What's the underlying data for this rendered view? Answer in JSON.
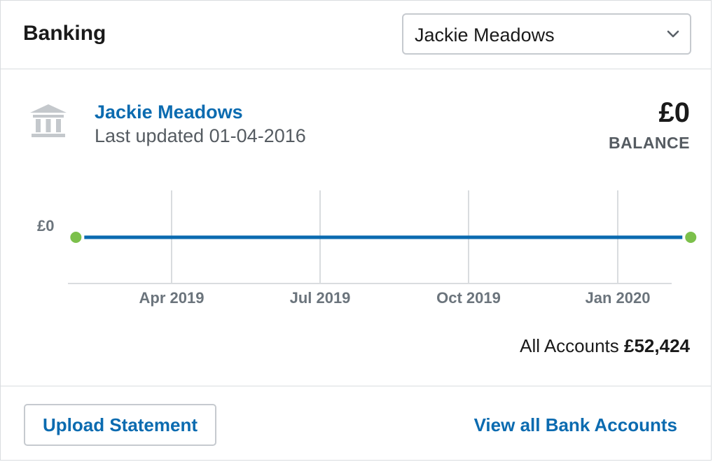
{
  "header": {
    "title": "Banking",
    "account_select": {
      "selected": "Jackie Meadows",
      "icon": "chevron-down-icon"
    }
  },
  "account": {
    "icon": "bank-icon",
    "name": "Jackie Meadows",
    "last_updated": "Last updated 01-04-2016",
    "balance": "£0",
    "balance_label": "BALANCE"
  },
  "colors": {
    "link": "#0b6bb0",
    "line": "#0b6bb0",
    "endpoint": "#7cc04b",
    "grid": "#d9dcdf"
  },
  "chart_data": {
    "type": "line",
    "y_tick_labels": [
      "£0"
    ],
    "x_tick_labels": [
      "Apr 2019",
      "Jul 2019",
      "Oct 2019",
      "Jan 2020"
    ],
    "series": [
      {
        "x": [
          "2019-02-01",
          "2020-02-15"
        ],
        "values": [
          0,
          0
        ]
      }
    ],
    "grid": "vertical"
  },
  "summary": {
    "label": "All Accounts",
    "value": "£52,424"
  },
  "footer": {
    "upload_label": "Upload Statement",
    "view_all_label": "View all Bank Accounts"
  }
}
